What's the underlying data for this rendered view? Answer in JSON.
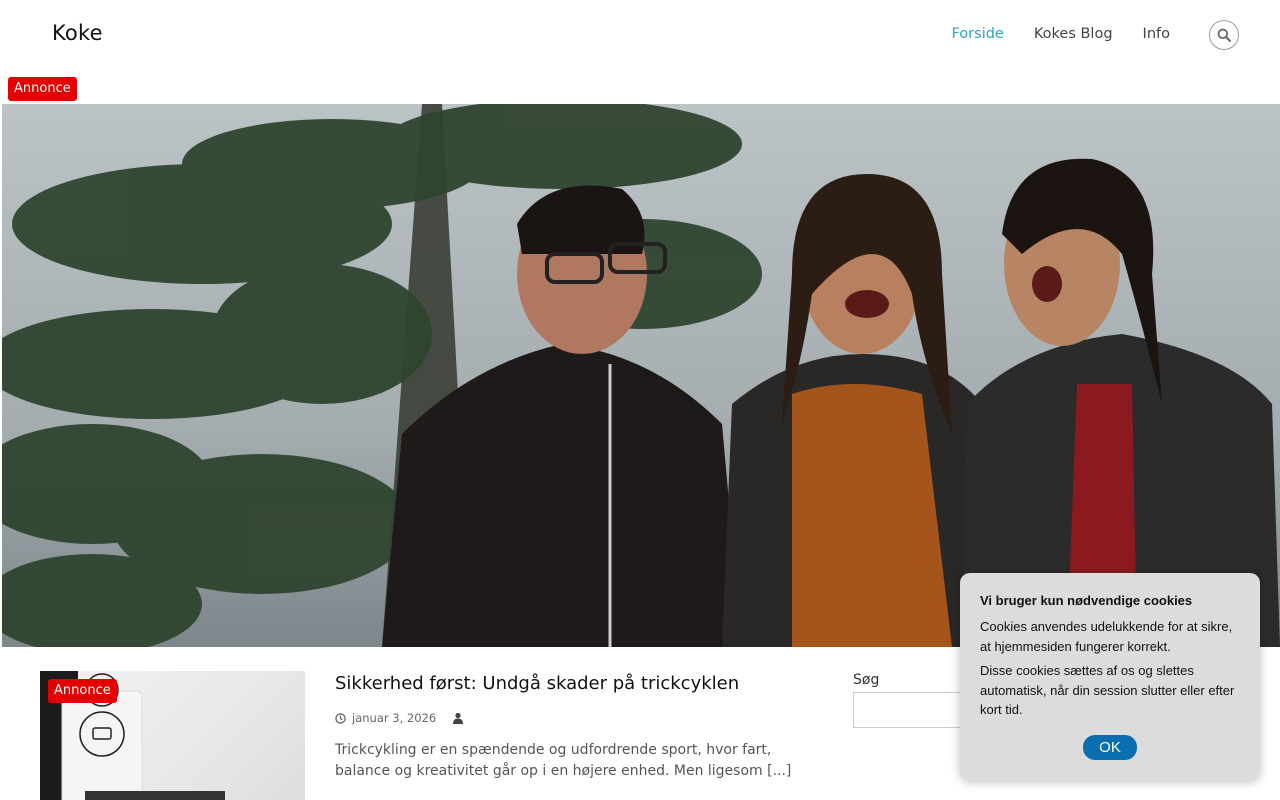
{
  "header": {
    "site_title": "Koke",
    "nav": [
      {
        "label": "Forside",
        "active": true
      },
      {
        "label": "Kokes Blog",
        "active": false
      },
      {
        "label": "Info",
        "active": false
      }
    ],
    "search_icon": "search-icon"
  },
  "ad_label": "Annonce",
  "hero": {
    "image": "three people laughing outdoors in front of pine tree"
  },
  "post": {
    "ad_label": "Annonce",
    "title": "Sikkerhed først: Undgå skader på trickcyklen",
    "date": "januar 3, 2026",
    "excerpt": "Trickcykling er en spændende og udfordrende sport, hvor fart, balance og kreativitet går op i en højere enhed. Men ligesom [...]"
  },
  "sidebar": {
    "search_label": "Søg"
  },
  "cookie": {
    "title": "Vi bruger kun nødvendige cookies",
    "text1": "Cookies anvendes udelukkende for at sikre, at hjemmesiden fungerer korrekt.",
    "text2": "Disse cookies sættes af os og slettes automatisk, når din session slutter eller efter kort tid.",
    "ok_label": "OK"
  },
  "colors": {
    "accent": "#2ba6c4",
    "ad": "#e40000",
    "cookie_button": "#0a6fb0"
  }
}
